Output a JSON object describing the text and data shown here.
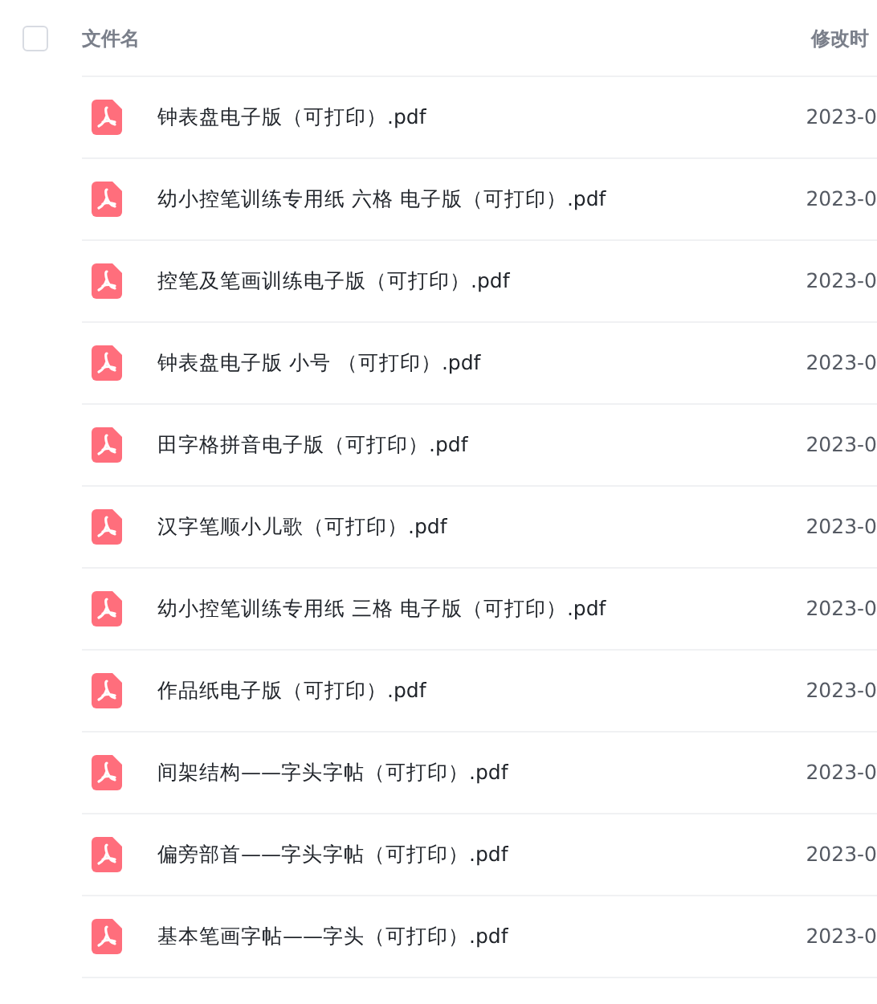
{
  "header": {
    "select_all": {
      "checked": false
    },
    "columns": [
      "文件名",
      "修改时"
    ]
  },
  "rows": [
    {
      "name": "钟表盘电子版（可打印）.pdf",
      "date": "2023-0"
    },
    {
      "name": "幼小控笔训练专用纸 六格 电子版（可打印）.pdf",
      "date": "2023-0"
    },
    {
      "name": "控笔及笔画训练电子版（可打印）.pdf",
      "date": "2023-0"
    },
    {
      "name": "钟表盘电子版 小号 （可打印）.pdf",
      "date": "2023-0"
    },
    {
      "name": "田字格拼音电子版（可打印）.pdf",
      "date": "2023-0"
    },
    {
      "name": "汉字笔顺小儿歌（可打印）.pdf",
      "date": "2023-0"
    },
    {
      "name": "幼小控笔训练专用纸 三格 电子版（可打印）.pdf",
      "date": "2023-0"
    },
    {
      "name": "作品纸电子版（可打印）.pdf",
      "date": "2023-0"
    },
    {
      "name": "间架结构——字头字帖（可打印）.pdf",
      "date": "2023-0"
    },
    {
      "name": "偏旁部首——字头字帖（可打印）.pdf",
      "date": "2023-0"
    },
    {
      "name": "基本笔画字帖——字头（可打印）.pdf",
      "date": "2023-0"
    }
  ]
}
